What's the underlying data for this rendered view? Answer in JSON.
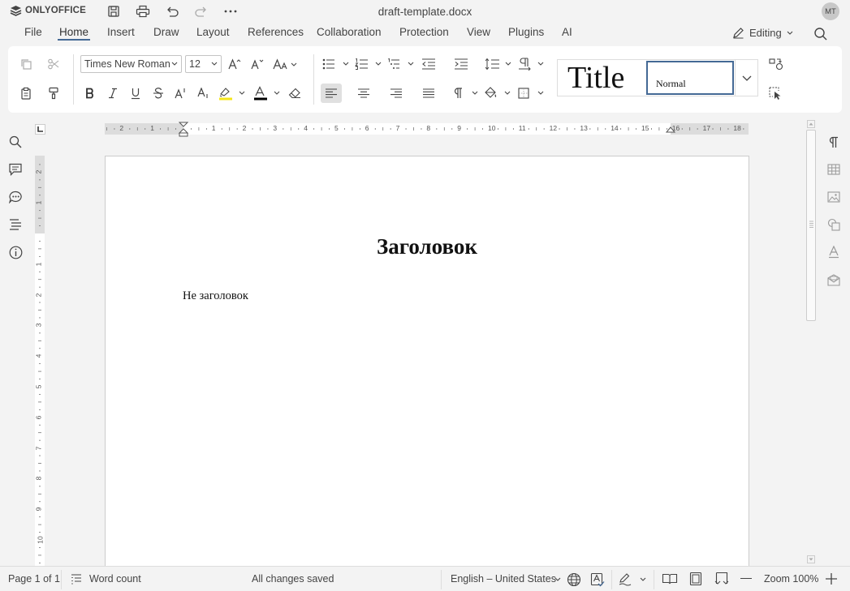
{
  "app": {
    "name": "ONLYOFFICE",
    "doc_title": "draft-template.docx",
    "user_initials": "MT"
  },
  "menu": {
    "tabs": [
      {
        "label": "File"
      },
      {
        "label": "Home"
      },
      {
        "label": "Insert"
      },
      {
        "label": "Draw"
      },
      {
        "label": "Layout"
      },
      {
        "label": "References"
      },
      {
        "label": "Collaboration"
      },
      {
        "label": "Protection"
      },
      {
        "label": "View"
      },
      {
        "label": "Plugins"
      },
      {
        "label": "AI"
      }
    ],
    "active_tab": "Home",
    "mode_label": "Editing"
  },
  "toolbar": {
    "font_name": "Times New Roman",
    "font_size": "12",
    "styles": {
      "title_label": "Title",
      "normal_label": "Normal"
    },
    "highlight_color": "#f5e61a",
    "font_color": "#000000"
  },
  "ruler": {
    "h_numbers": [
      "2",
      "1",
      "1",
      "2",
      "3",
      "4",
      "5",
      "6",
      "7",
      "8",
      "9",
      "10",
      "11",
      "12",
      "13",
      "14",
      "15",
      "16",
      "17",
      "18"
    ],
    "v_numbers": [
      "2",
      "1",
      "1",
      "2",
      "3",
      "4",
      "5",
      "6",
      "7",
      "8",
      "9",
      "10"
    ]
  },
  "document": {
    "heading": "Заголовок",
    "paragraph": "Не заголовок"
  },
  "status": {
    "page_info": "Page 1 of 1",
    "word_count": "Word count",
    "save_status": "All changes saved",
    "language": "English – United States",
    "zoom": "Zoom 100%"
  },
  "colors": {
    "accent": "#446995",
    "background": "#f3f3f3"
  }
}
